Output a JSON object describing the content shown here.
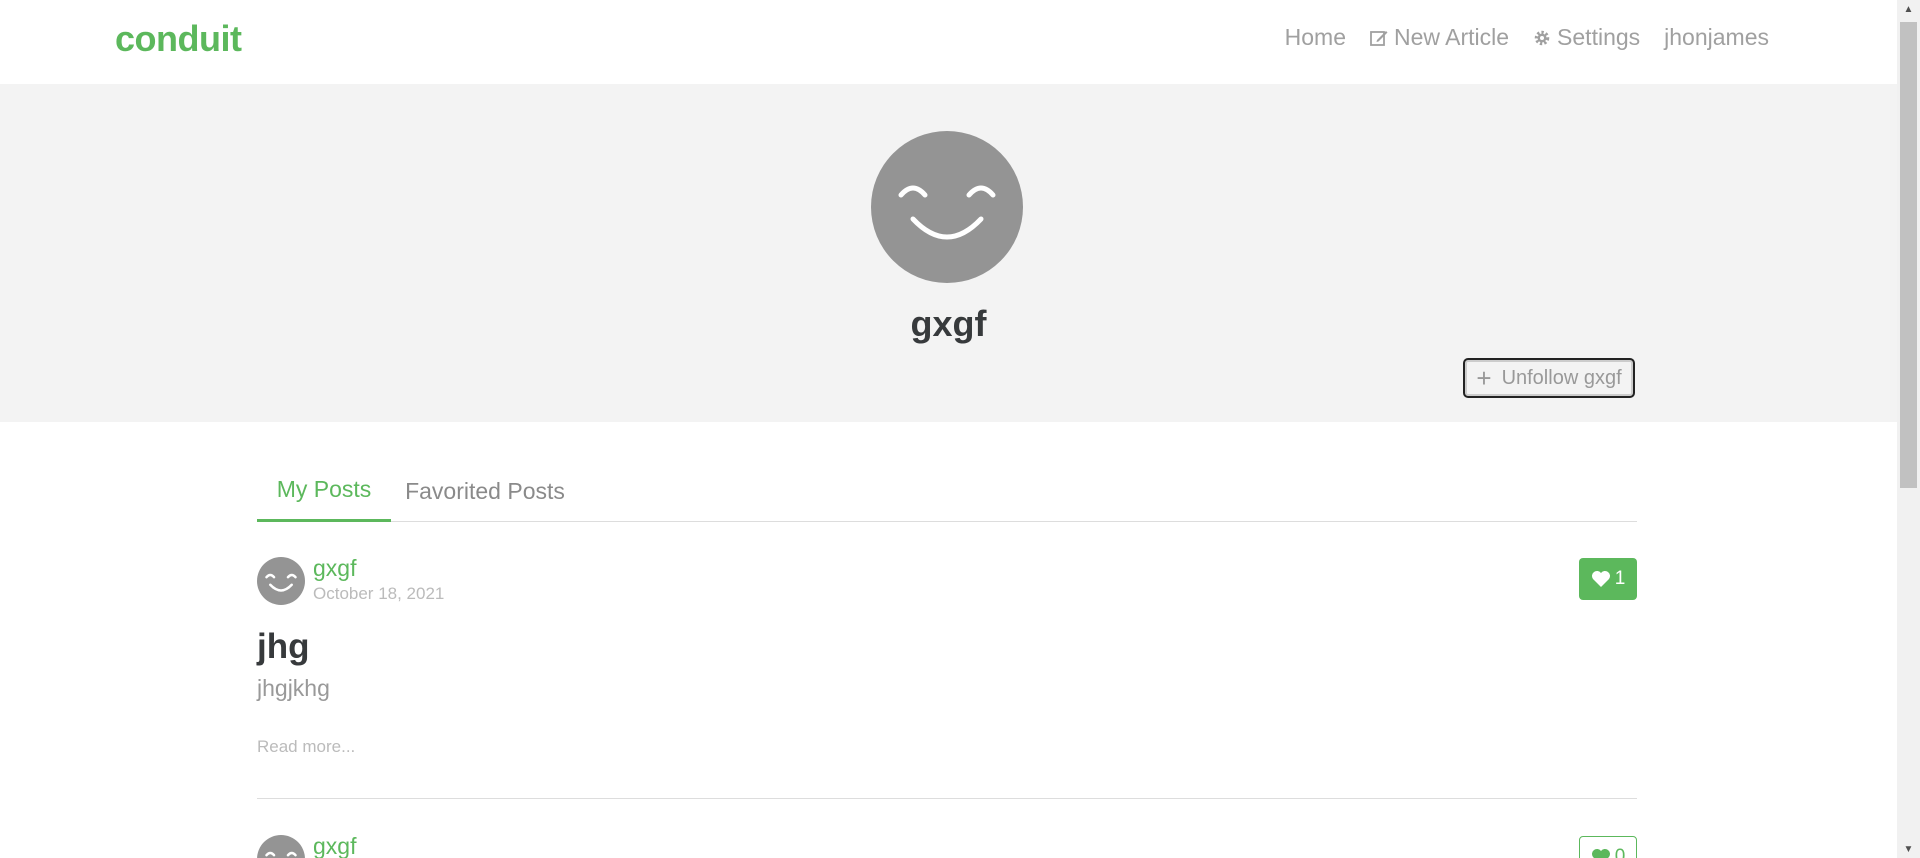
{
  "brand": "conduit",
  "nav": {
    "home": "Home",
    "new_article": "New Article",
    "settings": "Settings",
    "user": "jhonjames"
  },
  "profile": {
    "username": "gxgf",
    "unfollow_label": "Unfollow gxgf"
  },
  "tabs": {
    "my_posts": "My Posts",
    "favorited_posts": "Favorited Posts"
  },
  "articles": [
    {
      "author": "gxgf",
      "date": "October 18, 2021",
      "likes": "1",
      "title": "jhg",
      "description": "jhgjkhg",
      "read_more": "Read more..."
    },
    {
      "author": "gxgf",
      "likes": "0"
    }
  ],
  "colors": {
    "accent": "#5cb85c",
    "banner_bg": "#f3f3f3",
    "avatar": "#949494"
  }
}
